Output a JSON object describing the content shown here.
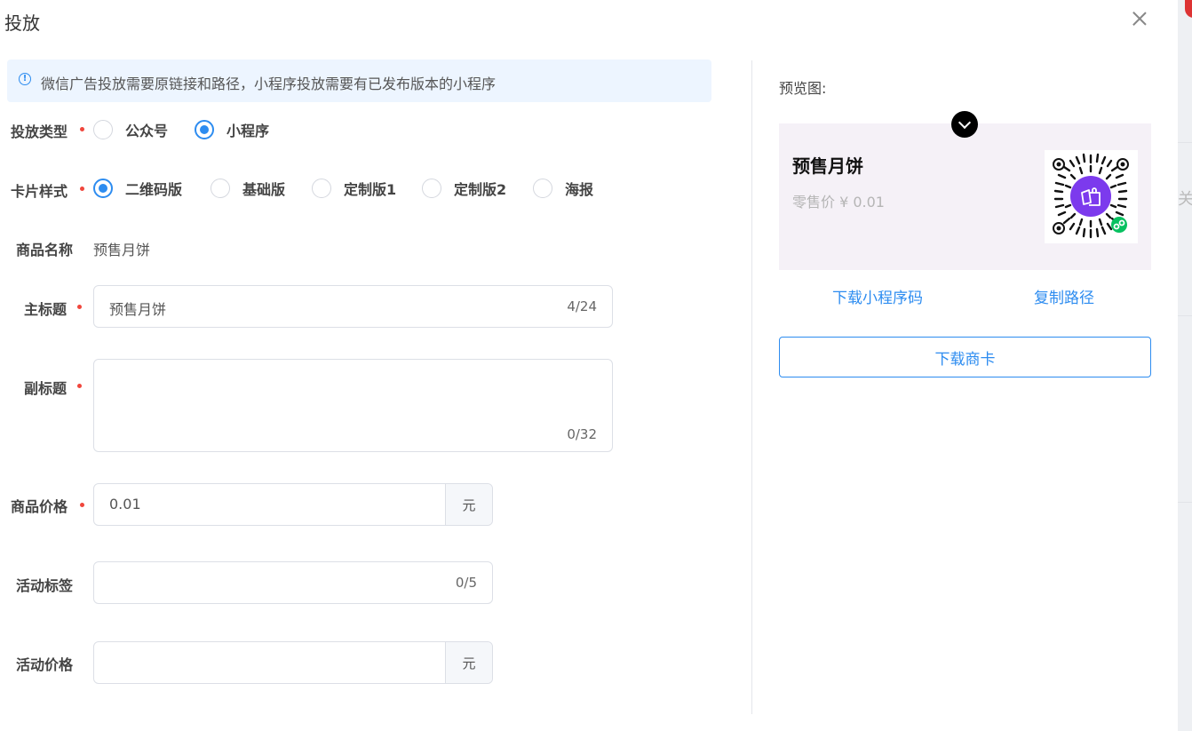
{
  "drawer": {
    "title": "投放"
  },
  "alert": {
    "text": "微信广告投放需要原链接和路径，小程序投放需要有已发布版本的小程序"
  },
  "form": {
    "delivery_type": {
      "label": "投放类型",
      "options": [
        "公众号",
        "小程序"
      ],
      "selected": "小程序"
    },
    "card_style": {
      "label": "卡片样式",
      "options": [
        "二维码版",
        "基础版",
        "定制版1",
        "定制版2",
        "海报"
      ],
      "selected": "二维码版"
    },
    "product_name": {
      "label": "商品名称",
      "value": "预售月饼"
    },
    "main_title": {
      "label": "主标题",
      "value": "预售月饼",
      "count": "4/24"
    },
    "subtitle": {
      "label": "副标题",
      "value": "",
      "count": "0/32"
    },
    "price": {
      "label": "商品价格",
      "value": "0.01",
      "suffix": "元"
    },
    "activity_tag": {
      "label": "活动标签",
      "value": "",
      "count": "0/5"
    },
    "activity_price": {
      "label": "活动价格",
      "value": "",
      "suffix": "元"
    }
  },
  "preview": {
    "label": "预览图:",
    "card_title": "预售月饼",
    "card_price": "零售价 ¥ 0.01",
    "download_qr": "下载小程序码",
    "copy_path": "复制路径",
    "download_card": "下载商卡"
  },
  "background": {
    "edge_char": "关"
  },
  "colors": {
    "primary": "#2d8cf0",
    "required": "#f0463c",
    "qr_center": "#7c3aed",
    "wechat_green": "#07c160"
  },
  "icons": {
    "close": "close-icon",
    "info": "info-icon",
    "chevron": "chevron-down-icon",
    "qr": "qr-code-icon"
  }
}
